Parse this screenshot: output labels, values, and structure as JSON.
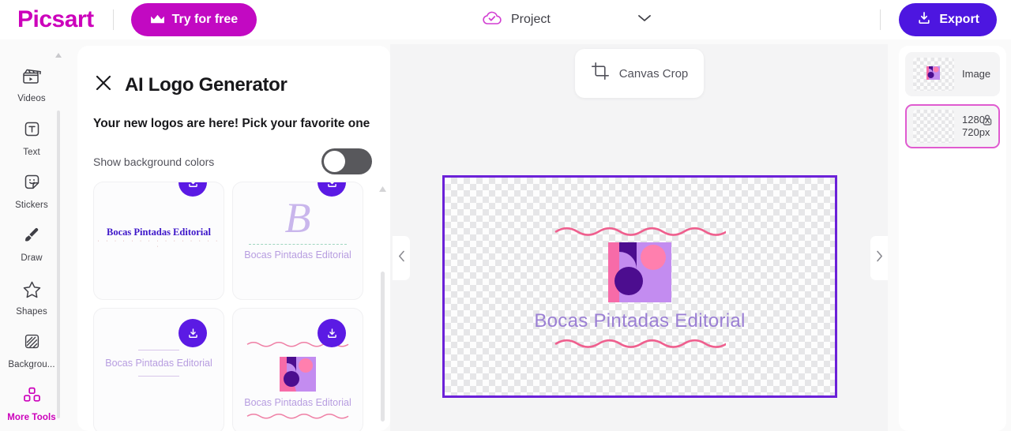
{
  "header": {
    "brand": "Picsart",
    "try_button": "Try for free",
    "try_icon": "crown-icon",
    "project_label": "Project",
    "project_icon": "cloud-check-icon",
    "chevron_icon": "chevron-down-icon",
    "export_button": "Export",
    "export_icon": "download-icon"
  },
  "sidebar": {
    "items": [
      {
        "label": "Videos",
        "icon": "video-clapper-icon",
        "active": false
      },
      {
        "label": "Text",
        "icon": "text-box-icon",
        "active": false
      },
      {
        "label": "Stickers",
        "icon": "sticker-icon",
        "active": false
      },
      {
        "label": "Draw",
        "icon": "paintbrush-icon",
        "active": false
      },
      {
        "label": "Shapes",
        "icon": "star-icon",
        "active": false
      },
      {
        "label": "Backgrou...",
        "icon": "background-hatch-icon",
        "active": false
      },
      {
        "label": "More Tools",
        "icon": "grid-squares-icon",
        "active": true
      }
    ]
  },
  "panel": {
    "close_icon": "close-icon",
    "title": "AI Logo Generator",
    "subtitle": "Your new logos are here! Pick your favorite one",
    "toggle_label": "Show background colors",
    "toggle_state": "off",
    "download_icon": "download-icon",
    "logos": [
      {
        "name": "Bocas Pintadas Editorial",
        "style": "serif-dotted"
      },
      {
        "name": "Bocas Pintadas Editorial",
        "style": "monogram-b"
      },
      {
        "name": "Bocas Pintadas Editorial",
        "style": "thin-lines"
      },
      {
        "name": "Bocas Pintadas Editorial",
        "style": "wave-square"
      }
    ]
  },
  "handles": {
    "left_icon": "chevron-left-icon",
    "right_icon": "chevron-right-icon"
  },
  "canvas": {
    "crop_button": "Canvas Crop",
    "crop_icon": "crop-icon",
    "artwork_text": "Bocas Pintadas Editorial",
    "selection_color": "#6b21d8",
    "wave_color": "#ef5f8e",
    "text_color": "#9b7fd4",
    "logo_colors": {
      "square_bg": "#f76ba8",
      "light_purple": "#c38cf0",
      "pink_circle": "#ff7fae",
      "dark_purple": "#4c0d8f"
    }
  },
  "layers": {
    "items": [
      {
        "name": "Image",
        "selected": false,
        "locked": false
      },
      {
        "name": "1280x\n720px",
        "selected": true,
        "locked": true
      }
    ],
    "lock_icon": "lock-icon"
  }
}
